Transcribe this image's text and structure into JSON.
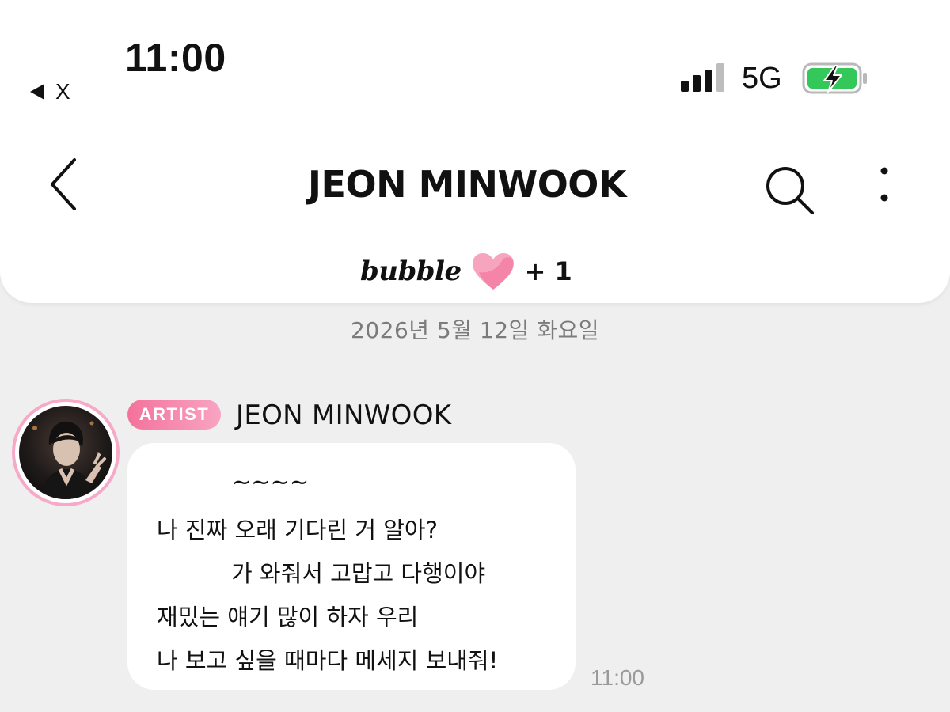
{
  "status_bar": {
    "time": "11:00",
    "back_app_label": "X",
    "network": "5G",
    "signal_icon": "cellular-signal-icon",
    "battery_icon": "battery-charging-icon",
    "battery_color": "#34c759"
  },
  "nav": {
    "title": "JEON MINWOOK",
    "back_icon": "chevron-left-icon",
    "search_icon": "search-icon",
    "more_icon": "more-vertical-icon"
  },
  "bubble_bar": {
    "brand": "bubble",
    "heart_icon": "heart-icon",
    "heart_color": "#f58fb0",
    "count": "+ 1"
  },
  "chat": {
    "date": "2026년 5월 12일 화요일",
    "message": {
      "badge": "ARTIST",
      "badge_color": "#f3729c",
      "sender": "JEON MINWOOK",
      "lines": [
        "~~~~",
        "나 진짜 오래 기다린 거 알아?",
        "가 와줘서 고맙고 다행이야",
        "재밌는 얘기 많이 하자 우리",
        "나 보고 싶을 때마다 메세지 보내줘!"
      ],
      "time": "11:00"
    }
  },
  "colors": {
    "background": "#efefef",
    "card": "#ffffff",
    "muted_text": "#7b7b7b",
    "avatar_ring": "#f7a9c8"
  }
}
